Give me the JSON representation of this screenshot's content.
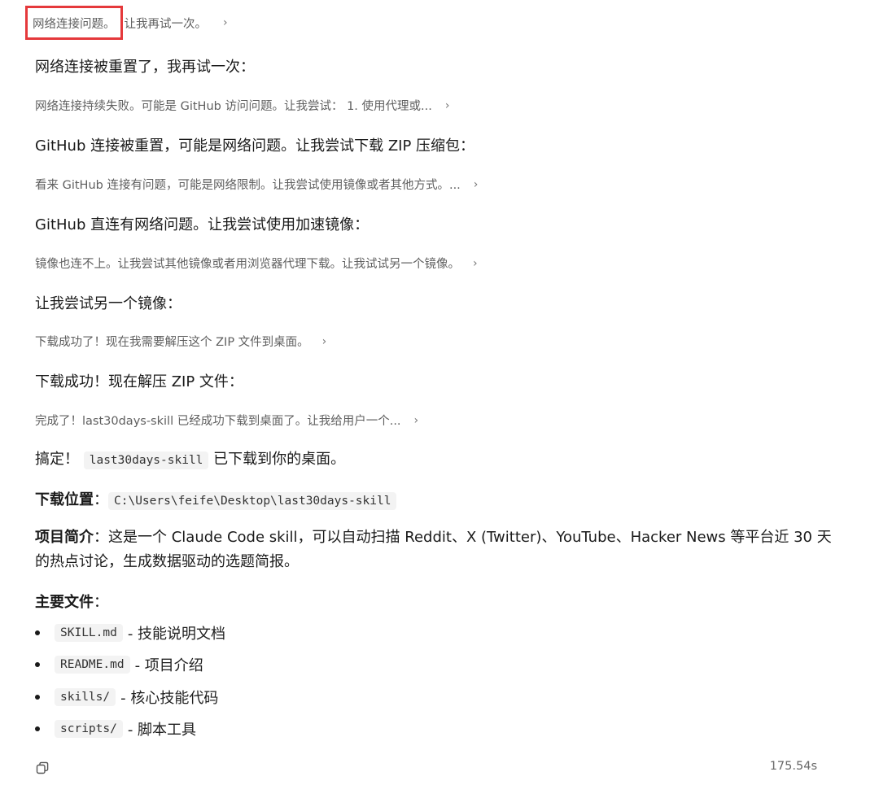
{
  "thread": {
    "first_thought": {
      "highlight": "网络连接问题。",
      "rest": "让我再试一次。"
    },
    "items": [
      {
        "kind": "msg",
        "text": "网络连接被重置了，我再试一次："
      },
      {
        "kind": "thought",
        "text": "网络连接持续失败。可能是 GitHub 访问问题。让我尝试： 1. 使用代理或..."
      },
      {
        "kind": "msg",
        "text": "GitHub 连接被重置，可能是网络问题。让我尝试下载 ZIP 压缩包："
      },
      {
        "kind": "thought",
        "text": "看来 GitHub 连接有问题，可能是网络限制。让我尝试使用镜像或者其他方式。..."
      },
      {
        "kind": "msg",
        "text": "GitHub 直连有网络问题。让我尝试使用加速镜像："
      },
      {
        "kind": "thought",
        "text": "镜像也连不上。让我尝试其他镜像或者用浏览器代理下载。让我试试另一个镜像。"
      },
      {
        "kind": "msg",
        "text": "让我尝试另一个镜像："
      },
      {
        "kind": "thought",
        "text": "下载成功了！现在我需要解压这个 ZIP 文件到桌面。"
      },
      {
        "kind": "msg",
        "text": "下载成功！现在解压 ZIP 文件："
      },
      {
        "kind": "thought",
        "text": "完成了！last30days-skill 已经成功下载到桌面了。让我给用户一个..."
      }
    ]
  },
  "answer": {
    "done_prefix": "搞定！",
    "done_code": "last30days-skill",
    "done_suffix": "已下载到你的桌面。",
    "location_label": "下载位置",
    "location_colon": "：",
    "location_path": "C:\\Users\\feife\\Desktop\\last30days-skill",
    "intro_label": "项目简介",
    "intro_text": "：这是一个 Claude Code skill，可以自动扫描 Reddit、X (Twitter)、YouTube、Hacker News 等平台近 30 天的热点讨论，生成数据驱动的选题简报。",
    "files_label": "主要文件",
    "files_colon": "：",
    "files": [
      {
        "name": "SKILL.md",
        "desc": "- 技能说明文档"
      },
      {
        "name": "README.md",
        "desc": "- 项目介绍"
      },
      {
        "name": "skills/",
        "desc": "- 核心技能代码"
      },
      {
        "name": "scripts/",
        "desc": "- 脚本工具"
      }
    ]
  },
  "footer": {
    "elapsed": "175.54s",
    "copy_icon": "copy-icon"
  },
  "icons": {
    "chevron": "›"
  },
  "colors": {
    "highlight_border": "#e5393b"
  }
}
